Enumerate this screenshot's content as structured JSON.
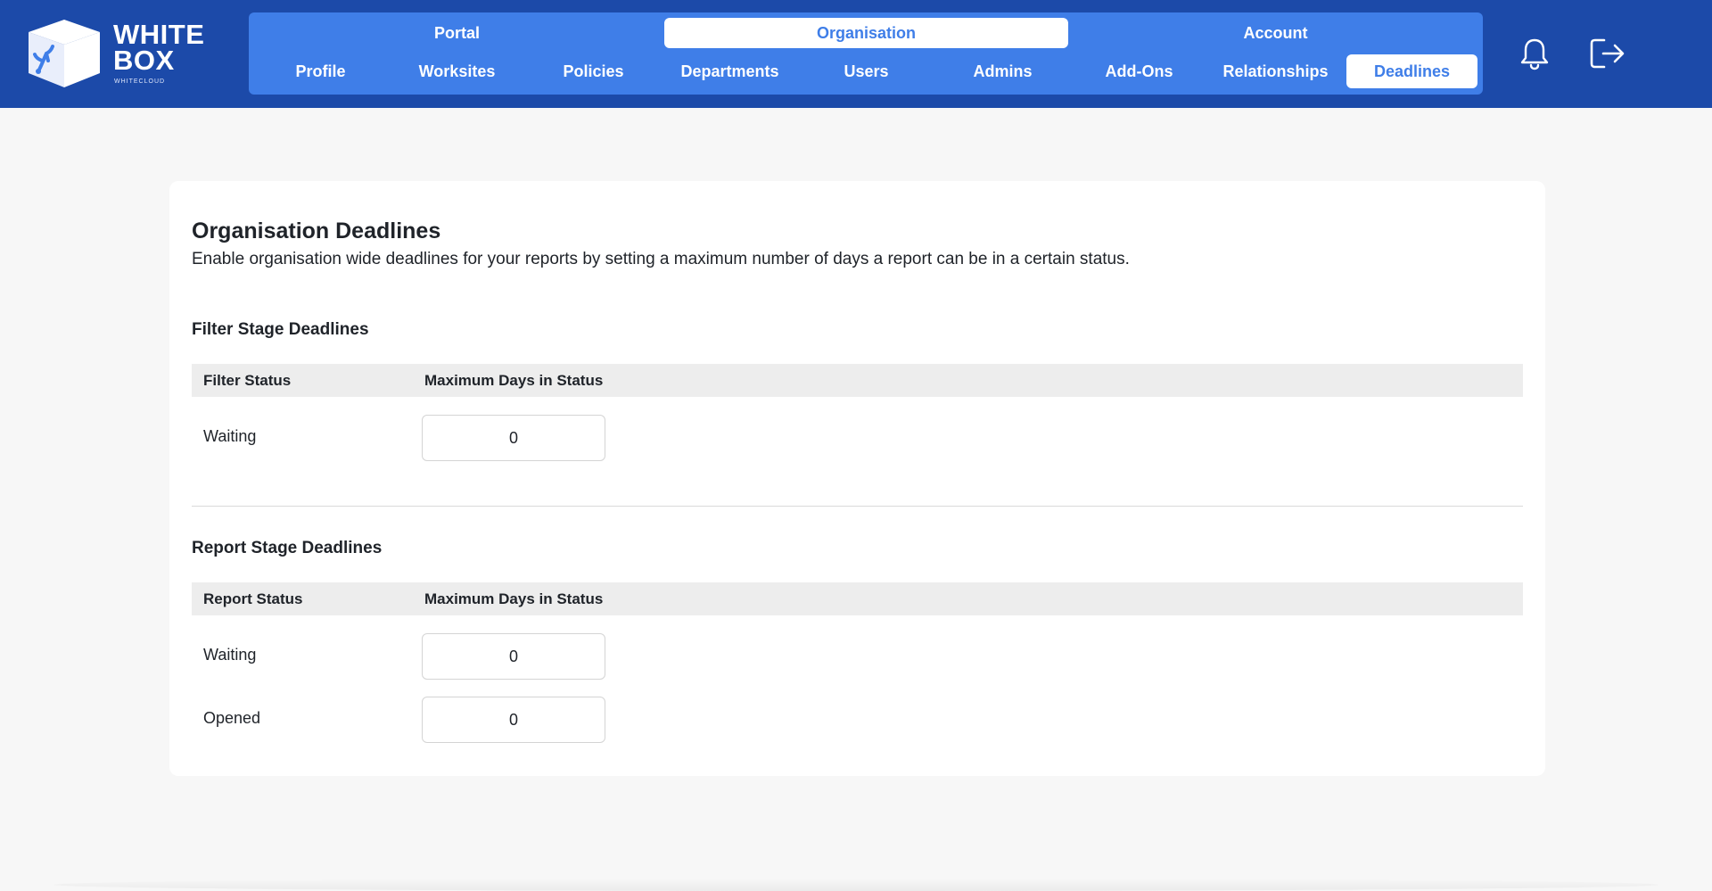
{
  "brand": {
    "line1": "WHITE",
    "line2": "BOX",
    "sub": "WHITECLOUD",
    "colors": {
      "header": "#1c4aa9",
      "nav": "#3f7ee8",
      "active_text": "#3f7ee8"
    }
  },
  "nav": {
    "top": [
      {
        "label": "Portal",
        "active": false
      },
      {
        "label": "Organisation",
        "active": true
      },
      {
        "label": "Account",
        "active": false
      }
    ],
    "sub": [
      {
        "label": "Profile",
        "active": false
      },
      {
        "label": "Worksites",
        "active": false
      },
      {
        "label": "Policies",
        "active": false
      },
      {
        "label": "Departments",
        "active": false
      },
      {
        "label": "Users",
        "active": false
      },
      {
        "label": "Admins",
        "active": false
      },
      {
        "label": "Add-Ons",
        "active": false
      },
      {
        "label": "Relationships",
        "active": false
      },
      {
        "label": "Deadlines",
        "active": true
      }
    ]
  },
  "header_icons": {
    "notifications": "bell-icon",
    "logout": "logout-icon"
  },
  "page": {
    "title": "Organisation Deadlines",
    "description": "Enable organisation wide deadlines for your reports by setting a maximum number of days a report can be in a certain status."
  },
  "filter_stage": {
    "title": "Filter Stage Deadlines",
    "col_status": "Filter Status",
    "col_days": "Maximum Days in Status",
    "rows": [
      {
        "status": "Waiting",
        "days": "0"
      }
    ]
  },
  "report_stage": {
    "title": "Report Stage Deadlines",
    "col_status": "Report Status",
    "col_days": "Maximum Days in Status",
    "rows": [
      {
        "status": "Waiting",
        "days": "0"
      },
      {
        "status": "Opened",
        "days": "0"
      }
    ]
  }
}
